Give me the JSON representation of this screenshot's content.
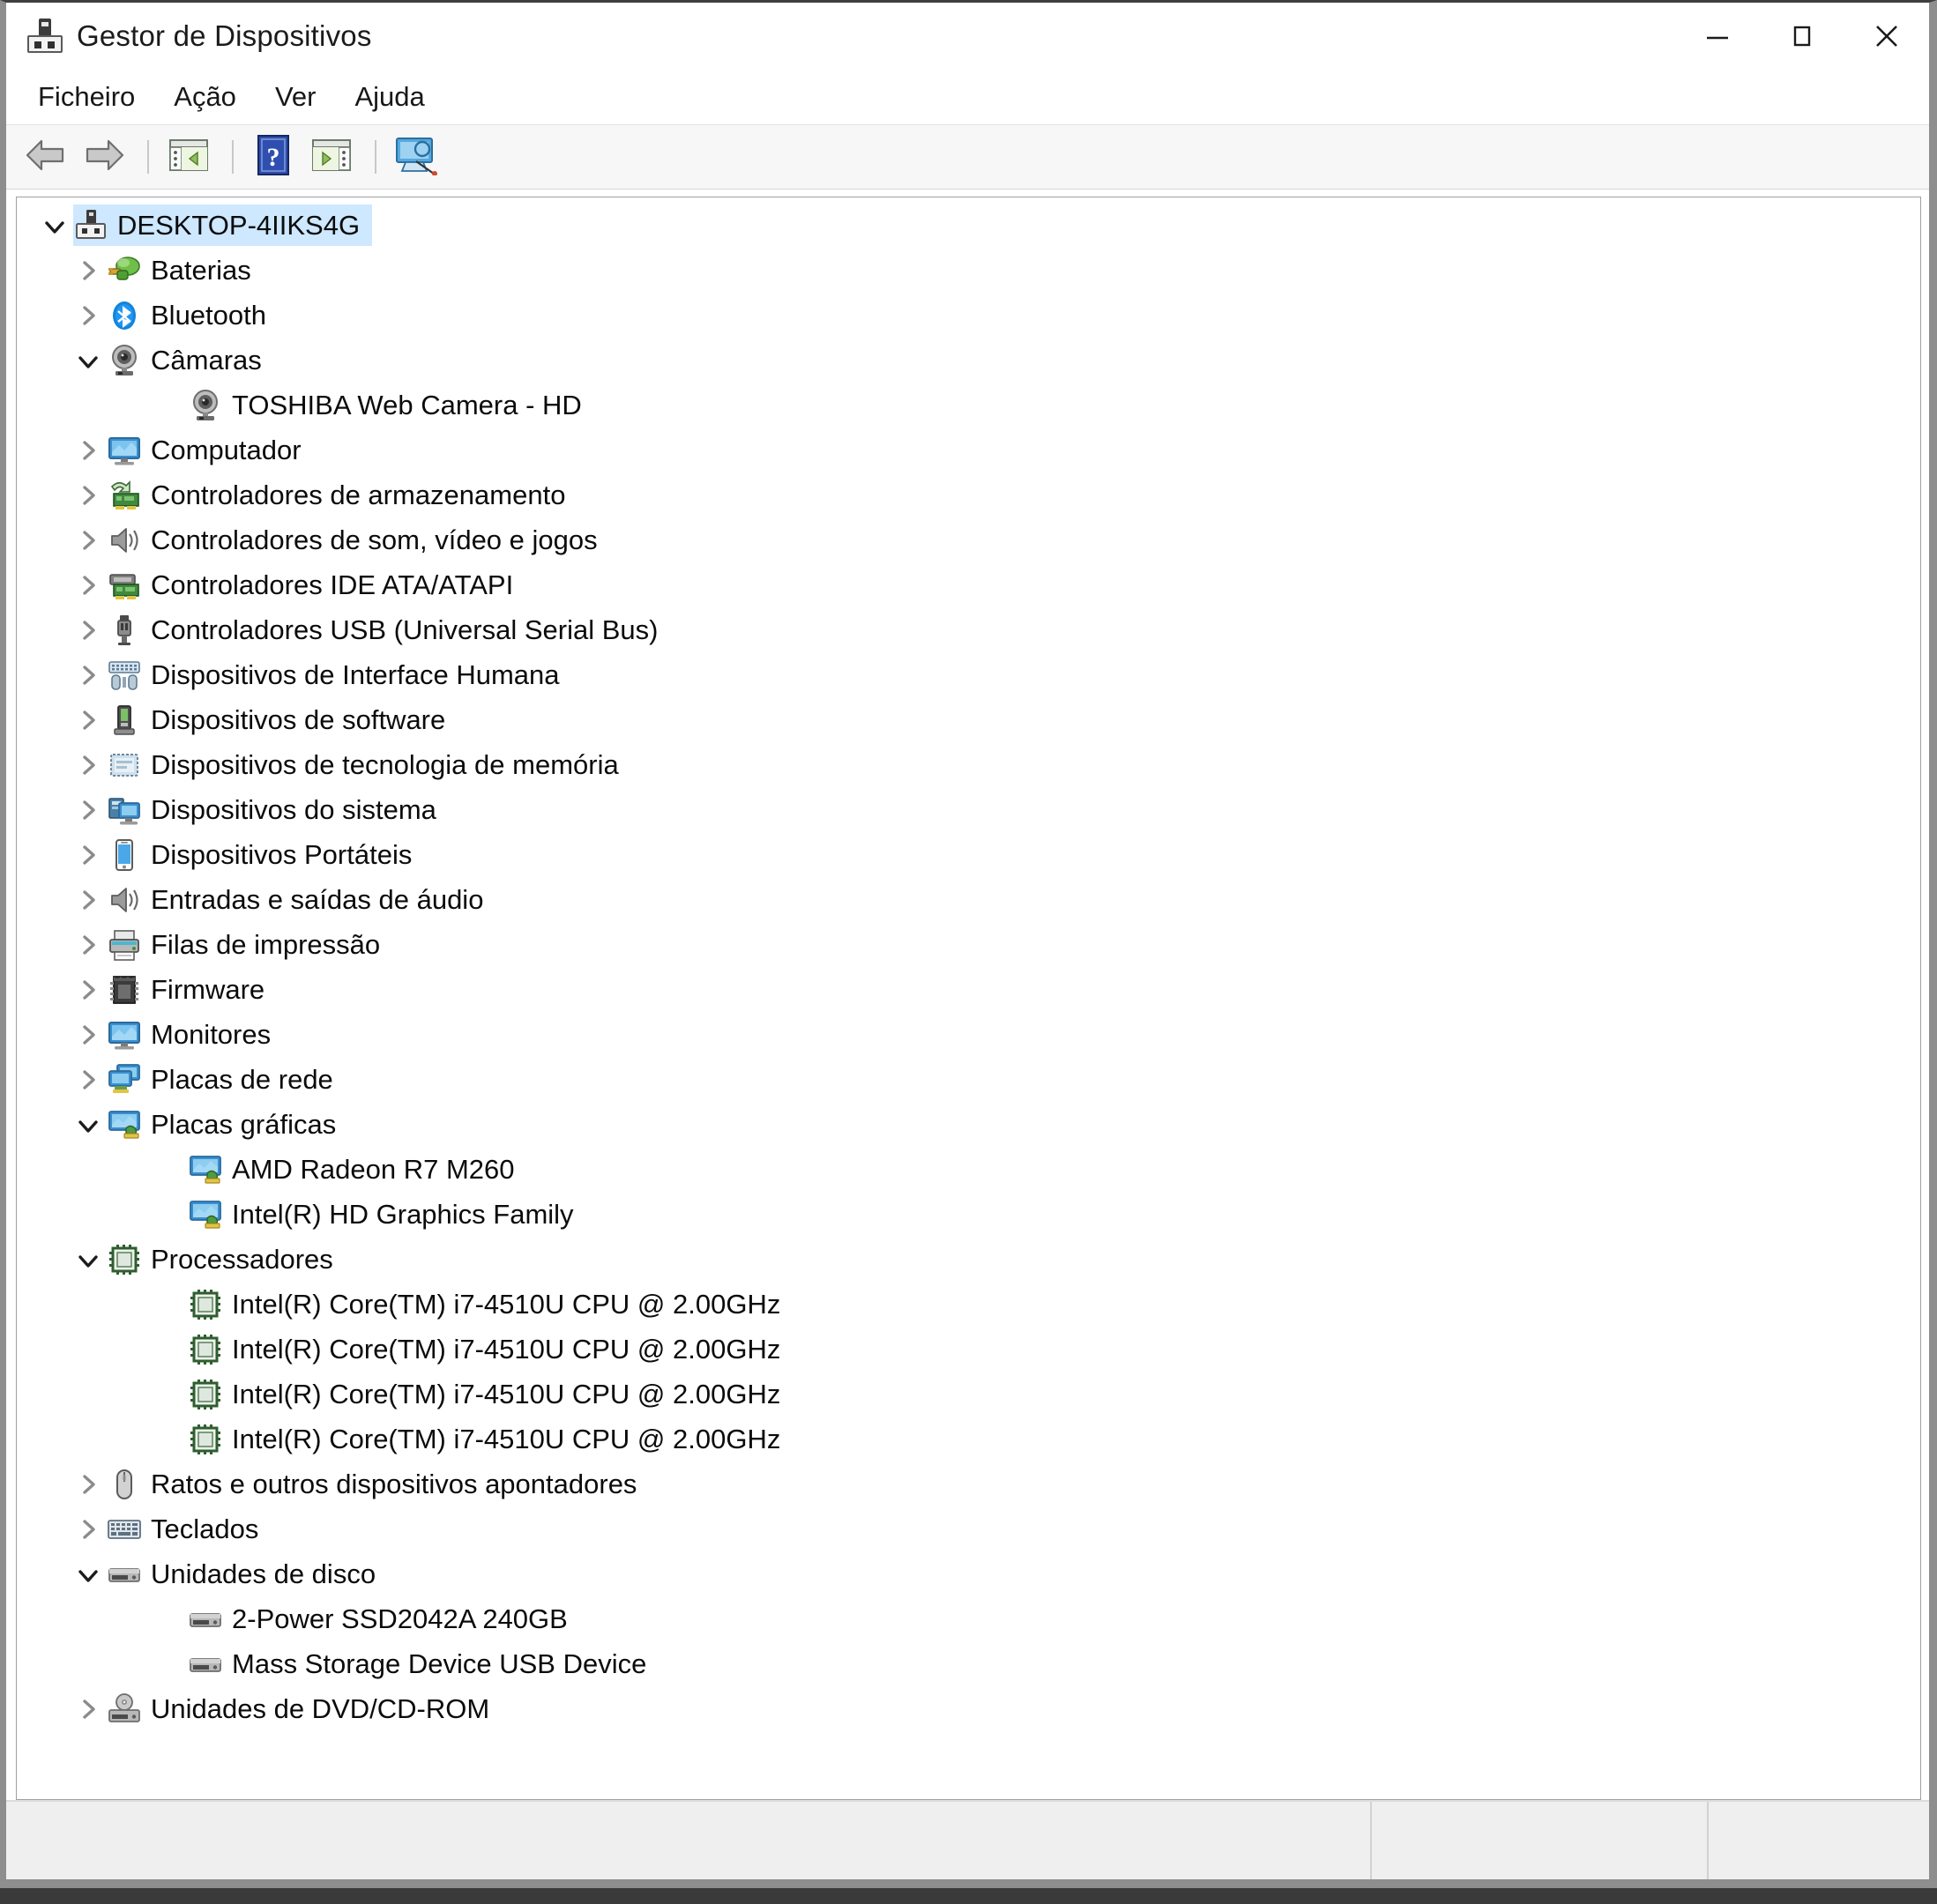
{
  "window": {
    "title": "Gestor de Dispositivos",
    "title_icon": "device-manager-icon",
    "controls": {
      "minimize": "–",
      "maximize": "□",
      "close": "✕"
    }
  },
  "menu": {
    "items": [
      {
        "label": "Ficheiro",
        "name": "menu-ficheiro"
      },
      {
        "label": "Ação",
        "name": "menu-acao"
      },
      {
        "label": "Ver",
        "name": "menu-ver"
      },
      {
        "label": "Ajuda",
        "name": "menu-ajuda"
      }
    ]
  },
  "toolbar": {
    "buttons": [
      {
        "name": "back-button",
        "icon": "arrow-left-icon"
      },
      {
        "name": "forward-button",
        "icon": "arrow-right-icon"
      },
      {
        "name": "show-hide-console-tree-button",
        "icon": "console-tree-icon"
      },
      {
        "name": "help-button",
        "icon": "question-mark-icon"
      },
      {
        "name": "properties-button",
        "icon": "properties-panel-icon"
      },
      {
        "name": "scan-hardware-changes-button",
        "icon": "scan-monitor-icon"
      }
    ]
  },
  "tree": {
    "root": {
      "label": "DESKTOP-4IIKS4G",
      "icon": "computer-root-icon",
      "expanded": true,
      "selected": true
    },
    "nodes": [
      {
        "label": "Baterias",
        "icon": "battery-icon",
        "expanded": false,
        "level": 1
      },
      {
        "label": "Bluetooth",
        "icon": "bluetooth-icon",
        "expanded": false,
        "level": 1
      },
      {
        "label": "Câmaras",
        "icon": "camera-icon",
        "expanded": true,
        "level": 1
      },
      {
        "label": "TOSHIBA Web Camera - HD",
        "icon": "camera-icon",
        "leaf": true,
        "level": 2
      },
      {
        "label": "Computador",
        "icon": "monitor-icon",
        "expanded": false,
        "level": 1
      },
      {
        "label": "Controladores de armazenamento",
        "icon": "storage-controller-icon",
        "expanded": false,
        "level": 1
      },
      {
        "label": "Controladores de som, vídeo e jogos",
        "icon": "speaker-icon",
        "expanded": false,
        "level": 1
      },
      {
        "label": "Controladores IDE ATA/ATAPI",
        "icon": "ide-controller-icon",
        "expanded": false,
        "level": 1
      },
      {
        "label": "Controladores USB (Universal Serial Bus)",
        "icon": "usb-icon",
        "expanded": false,
        "level": 1
      },
      {
        "label": "Dispositivos de Interface Humana",
        "icon": "hid-icon",
        "expanded": false,
        "level": 1
      },
      {
        "label": "Dispositivos de software",
        "icon": "software-device-icon",
        "expanded": false,
        "level": 1
      },
      {
        "label": "Dispositivos de tecnologia de memória",
        "icon": "memory-tech-icon",
        "expanded": false,
        "level": 1
      },
      {
        "label": "Dispositivos do sistema",
        "icon": "system-device-icon",
        "expanded": false,
        "level": 1
      },
      {
        "label": "Dispositivos Portáteis",
        "icon": "portable-device-icon",
        "expanded": false,
        "level": 1
      },
      {
        "label": "Entradas e saídas de áudio",
        "icon": "speaker-icon",
        "expanded": false,
        "level": 1
      },
      {
        "label": "Filas de impressão",
        "icon": "printer-icon",
        "expanded": false,
        "level": 1
      },
      {
        "label": "Firmware",
        "icon": "firmware-chip-icon",
        "expanded": false,
        "level": 1
      },
      {
        "label": "Monitores",
        "icon": "monitor-icon",
        "expanded": false,
        "level": 1
      },
      {
        "label": "Placas de rede",
        "icon": "network-adapter-icon",
        "expanded": false,
        "level": 1
      },
      {
        "label": "Placas gráficas",
        "icon": "display-adapter-icon",
        "expanded": true,
        "level": 1
      },
      {
        "label": "AMD Radeon R7 M260",
        "icon": "display-adapter-icon",
        "leaf": true,
        "level": 2
      },
      {
        "label": "Intel(R) HD Graphics Family",
        "icon": "display-adapter-icon",
        "leaf": true,
        "level": 2
      },
      {
        "label": "Processadores",
        "icon": "processor-icon",
        "expanded": true,
        "level": 1
      },
      {
        "label": "Intel(R) Core(TM) i7-4510U CPU @ 2.00GHz",
        "icon": "processor-icon",
        "leaf": true,
        "level": 2
      },
      {
        "label": "Intel(R) Core(TM) i7-4510U CPU @ 2.00GHz",
        "icon": "processor-icon",
        "leaf": true,
        "level": 2
      },
      {
        "label": "Intel(R) Core(TM) i7-4510U CPU @ 2.00GHz",
        "icon": "processor-icon",
        "leaf": true,
        "level": 2
      },
      {
        "label": "Intel(R) Core(TM) i7-4510U CPU @ 2.00GHz",
        "icon": "processor-icon",
        "leaf": true,
        "level": 2
      },
      {
        "label": "Ratos e outros dispositivos apontadores",
        "icon": "mouse-icon",
        "expanded": false,
        "level": 1
      },
      {
        "label": "Teclados",
        "icon": "keyboard-icon",
        "expanded": false,
        "level": 1
      },
      {
        "label": "Unidades de disco",
        "icon": "disk-drive-icon",
        "expanded": true,
        "level": 1
      },
      {
        "label": "2-Power SSD2042A 240GB",
        "icon": "disk-drive-icon",
        "leaf": true,
        "level": 2
      },
      {
        "label": "Mass Storage Device USB Device",
        "icon": "disk-drive-icon",
        "leaf": true,
        "level": 2
      },
      {
        "label": "Unidades de DVD/CD-ROM",
        "icon": "dvd-drive-icon",
        "expanded": false,
        "level": 1
      }
    ]
  },
  "statusbar": {
    "main_text": "",
    "segment_b_text": "",
    "segment_c_text": ""
  },
  "colors": {
    "selection": "#cde8ff",
    "window_bg": "#ffffff",
    "toolbar_bg": "#f7f7f7",
    "statusbar_bg": "#efefef",
    "text": "#0b0b0b",
    "chevron_collapsed": "#8b8b8b",
    "chevron_expanded": "#1c1c1c"
  }
}
